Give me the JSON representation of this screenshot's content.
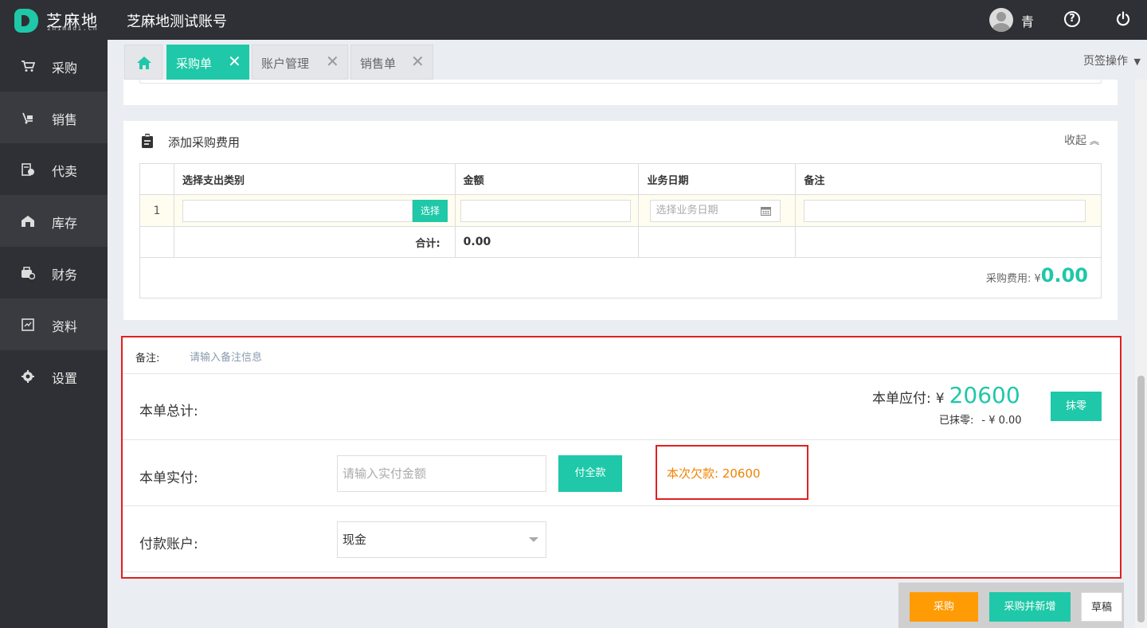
{
  "header": {
    "logo_text": "芝麻地",
    "logo_sub": "zhimadi.cn",
    "company": "芝麻地测试账号",
    "username": "青"
  },
  "sidebar": {
    "items": [
      {
        "label": "采购",
        "icon": "cart-icon"
      },
      {
        "label": "销售",
        "icon": "scale-icon"
      },
      {
        "label": "代卖",
        "icon": "consign-icon"
      },
      {
        "label": "库存",
        "icon": "warehouse-icon"
      },
      {
        "label": "财务",
        "icon": "finance-icon"
      },
      {
        "label": "资料",
        "icon": "info-icon"
      },
      {
        "label": "设置",
        "icon": "gear-icon"
      }
    ]
  },
  "tabs": {
    "items": [
      {
        "label": "采购单",
        "active": true
      },
      {
        "label": "账户管理",
        "active": false
      },
      {
        "label": "销售单",
        "active": false
      }
    ],
    "close_glyph": "✕",
    "ops_label": "页签操作",
    "ops_caret": "▼"
  },
  "fee_panel": {
    "title": "添加采购费用",
    "collapse_label": "收起",
    "collapse_glyph": "︽",
    "columns": [
      "选择支出类别",
      "金额",
      "业务日期",
      "备注"
    ],
    "row_index": "1",
    "choose_label": "选择",
    "date_placeholder": "选择业务日期",
    "sum_label": "合计:",
    "sum_value": "0.00",
    "total_label": "采购费用:",
    "total_currency": "¥",
    "total_value": "0.00"
  },
  "summary": {
    "note_label": "备注:",
    "note_placeholder": "请输入备注信息",
    "total_label": "本单总计:",
    "payable_label": "本单应付:",
    "payable_currency": "¥",
    "payable_value": "20600",
    "rounded_label": "已抹零:",
    "rounded_value": "- ¥ 0.00",
    "round_button": "抹零",
    "paid_label": "本单实付:",
    "paid_placeholder": "请输入实付金额",
    "pay_all_button": "付全款",
    "debt_text": "本次欠款:  20600",
    "account_label": "付款账户:",
    "account_value": "现金"
  },
  "actions": {
    "purchase": "采购",
    "purchase_new": "采购并新增",
    "draft": "草稿"
  },
  "colors": {
    "accent": "#1ec8a8",
    "warning": "#f08300",
    "orange_button": "#ff9b05",
    "highlight_border": "#e02020",
    "dark_bg": "#2f3035"
  }
}
